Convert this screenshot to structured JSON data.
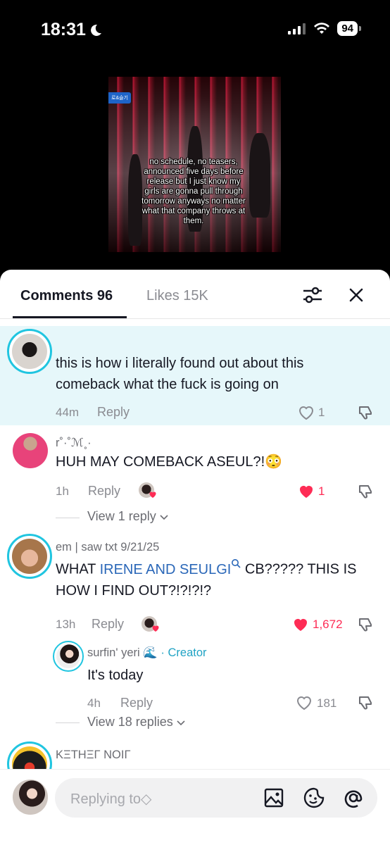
{
  "status_bar": {
    "time": "18:31",
    "battery": "94"
  },
  "video": {
    "tag": "로&슬기",
    "caption": "no schedule, no teasers, announced five days before release but I just know my girls are gonna pull through tomorrow anyways no matter what that company throws at them."
  },
  "tabs": {
    "comments": "Comments 96",
    "likes": "Likes 15K"
  },
  "comments": [
    {
      "text": "this is how i literally found out about this comeback what the fuck is going on",
      "time": "44m",
      "reply": "Reply",
      "likes": "1"
    },
    {
      "username": "r˚·˚ℳ˳·",
      "text": "HUH MAY COMEBACK ASEUL?!😳",
      "time": "1h",
      "reply": "Reply",
      "likes": "1",
      "view_replies": "View 1 reply"
    },
    {
      "username": "em | saw txt 9/21/25",
      "text_a": "WHAT ",
      "text_link": "IRENE AND SEULGI",
      "text_b": " CB????? THIS IS",
      "text_line2": "HOW I FIND OUT?!?!?!?",
      "time": "13h",
      "reply": "Reply",
      "likes": "1,672",
      "view_replies": "View 18 replies"
    },
    {
      "username": "KΞTHΞΓ NOIΓ"
    }
  ],
  "nested_reply": {
    "username": "surfin' yeri 🌊",
    "badge": "· Creator",
    "text": "It's today",
    "time": "4h",
    "reply": "Reply",
    "likes": "181"
  },
  "input": {
    "placeholder": "Replying to◇"
  },
  "colors": {
    "accent_red": "#fe2c55",
    "ring_cyan": "#20c5e0",
    "pinned_bg": "#e6f7fa"
  }
}
